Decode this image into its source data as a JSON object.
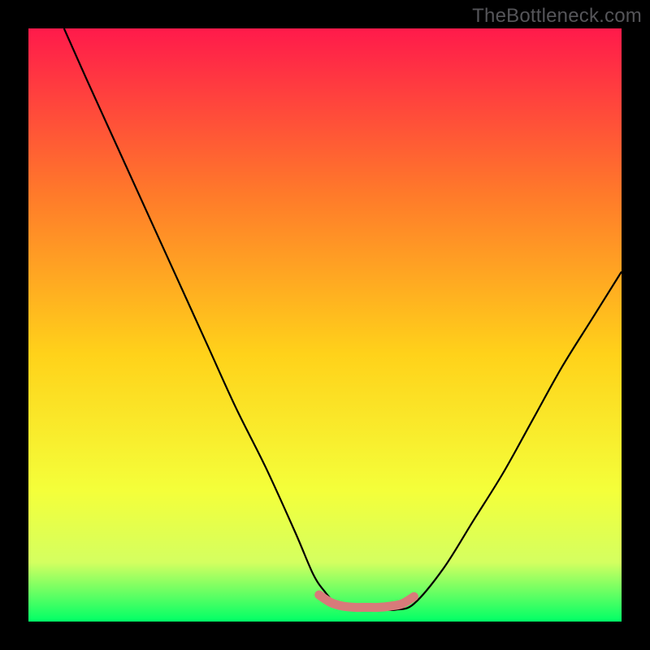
{
  "watermark": "TheBottleneck.com",
  "colors": {
    "bg_black": "#000000",
    "gradient_top": "#ff1a4b",
    "gradient_upper_mid": "#ff7a2a",
    "gradient_mid": "#ffd21a",
    "gradient_lower_mid": "#f4ff3a",
    "gradient_low": "#d4ff60",
    "gradient_bottom": "#00ff66",
    "curve": "#000000",
    "pink_region": "#d87a7a",
    "watermark_color": "#555559"
  },
  "chart_data": {
    "type": "line",
    "title": "",
    "xlabel": "",
    "ylabel": "",
    "xlim": [
      0,
      100
    ],
    "ylim": [
      0,
      100
    ],
    "series": [
      {
        "name": "bottleneck-curve",
        "x": [
          6,
          10,
          15,
          20,
          25,
          30,
          35,
          40,
          45,
          48,
          50,
          52,
          55,
          58,
          60,
          62,
          65,
          70,
          75,
          80,
          85,
          90,
          95,
          100
        ],
        "y": [
          100,
          91,
          80,
          69,
          58,
          47,
          36,
          26,
          15,
          8,
          5,
          3,
          2,
          2,
          2,
          2,
          3,
          9,
          17,
          25,
          34,
          43,
          51,
          59
        ]
      },
      {
        "name": "optimal-region-marker",
        "x": [
          49,
          51,
          53,
          55,
          57,
          59,
          61,
          63,
          65
        ],
        "y": [
          4.5,
          3.2,
          2.6,
          2.4,
          2.4,
          2.4,
          2.6,
          3.0,
          4.2
        ]
      }
    ],
    "gradient_stops": [
      {
        "offset": 0.0,
        "color": "#ff1a4b"
      },
      {
        "offset": 0.28,
        "color": "#ff7a2a"
      },
      {
        "offset": 0.55,
        "color": "#ffd21a"
      },
      {
        "offset": 0.78,
        "color": "#f4ff3a"
      },
      {
        "offset": 0.9,
        "color": "#d4ff60"
      },
      {
        "offset": 1.0,
        "color": "#00ff66"
      }
    ]
  }
}
